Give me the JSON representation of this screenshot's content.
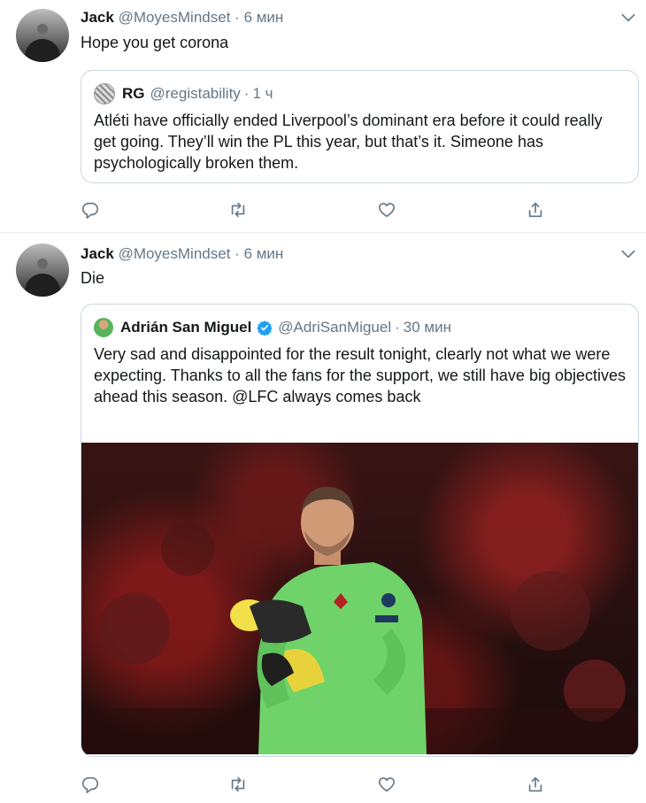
{
  "tweets": [
    {
      "author": {
        "name": "Jack",
        "handle": "@MoyesMindset",
        "time": "6 мин"
      },
      "text": "Hope you get corona",
      "quote": {
        "name": "RG",
        "handle": "@registability",
        "time": "1 ч",
        "verified": false,
        "text": "Atléti have officially ended Liverpool’s dominant era before it could really get going. They’ll win the PL this year, but that’s it. Simeone has psychologically broken them."
      }
    },
    {
      "author": {
        "name": "Jack",
        "handle": "@MoyesMindset",
        "time": "6 мин"
      },
      "text": "Die",
      "quote": {
        "name": "Adrián San Miguel",
        "handle": "@AdriSanMiguel",
        "time": "30 мин",
        "verified": true,
        "text": "Very sad and disappointed for the result tonight, clearly not what we were expecting. Thanks to all the fans for the support, we still have big objectives ahead this season. @LFC always comes back",
        "media": "photo"
      }
    }
  ],
  "separator": "·",
  "colors": {
    "text": "#14171a",
    "muted": "#657786",
    "border": "#ccd6dd",
    "verified": "#1da1f2",
    "kit": "#6fd36a"
  },
  "icons": [
    "reply-icon",
    "retweet-icon",
    "like-icon",
    "share-icon",
    "chevron-down-icon",
    "verified-badge-icon"
  ]
}
